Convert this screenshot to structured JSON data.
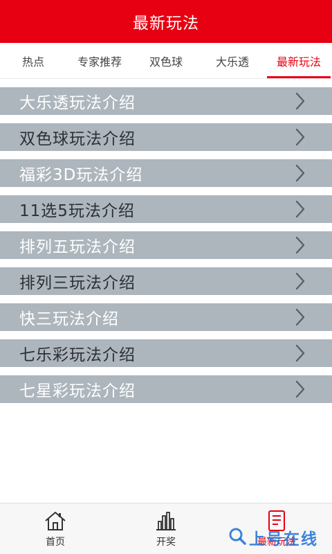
{
  "header": {
    "title": "最新玩法"
  },
  "tabs": [
    {
      "label": "热点",
      "active": false
    },
    {
      "label": "专家推荐",
      "active": false
    },
    {
      "label": "双色球",
      "active": false
    },
    {
      "label": "大乐透",
      "active": false
    },
    {
      "label": "最新玩法",
      "active": true
    }
  ],
  "list": {
    "items": [
      {
        "label": "大乐透玩法介绍"
      },
      {
        "label": "双色球玩法介绍"
      },
      {
        "label": "福彩3D玩法介绍"
      },
      {
        "label": "11选5玩法介绍"
      },
      {
        "label": "排列五玩法介绍"
      },
      {
        "label": "排列三玩法介绍"
      },
      {
        "label": "快三玩法介绍"
      },
      {
        "label": "七乐彩玩法介绍"
      },
      {
        "label": "七星彩玩法介绍"
      }
    ]
  },
  "bottom_nav": {
    "items": [
      {
        "label": "首页",
        "icon": "home-icon"
      },
      {
        "label": "开奖",
        "icon": "bar-chart-icon"
      },
      {
        "label": "最新玩法",
        "icon": "document-icon",
        "active": true
      }
    ]
  },
  "watermark": {
    "text": "上号在线"
  },
  "colors": {
    "brand_red": "#e60012",
    "row_bg": "#adb6bd",
    "watermark_blue": "#1f6fd6"
  }
}
